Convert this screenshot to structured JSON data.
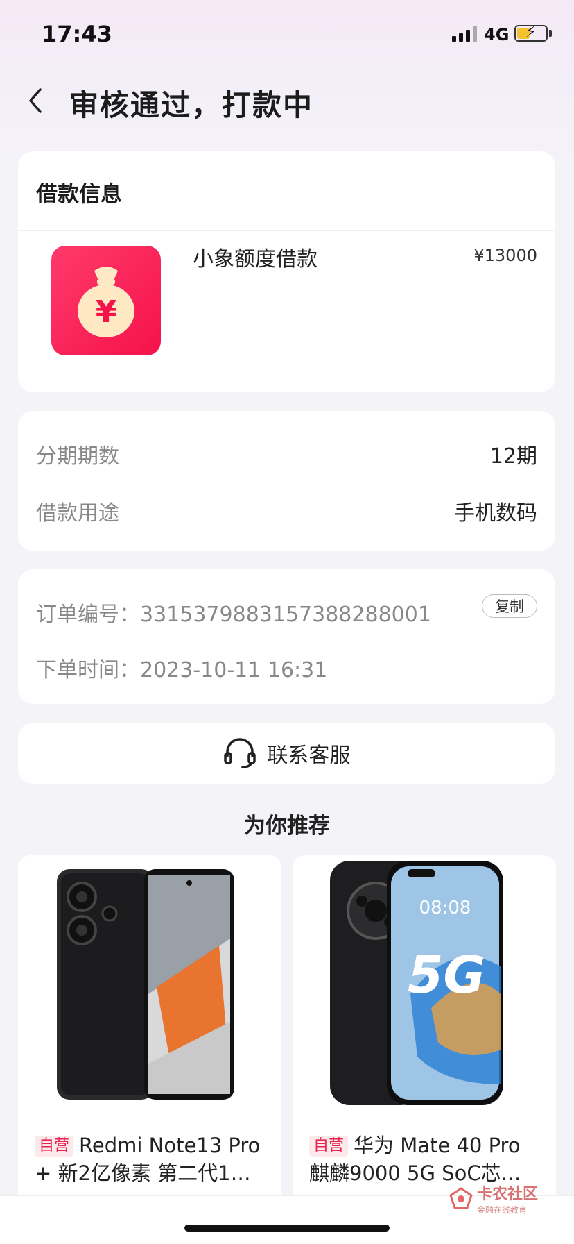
{
  "status": {
    "time": "17:43",
    "network": "4G"
  },
  "header": {
    "title": "审核通过，打款中"
  },
  "loan_info": {
    "section_title": "借款信息",
    "product_name": "小象额度借款",
    "amount": "¥13000",
    "icon": "money-bag-icon"
  },
  "details": {
    "rows": [
      {
        "label": "分期期数",
        "value": "12期"
      },
      {
        "label": "借款用途",
        "value": "手机数码"
      }
    ]
  },
  "order": {
    "number_label": "订单编号：",
    "number": "3315379883157388288001",
    "copy_label": "复制",
    "time_label": "下单时间：",
    "time": "2023-10-11 16:31"
  },
  "support": {
    "label": "联系客服",
    "icon": "headset-icon"
  },
  "recommend": {
    "title": "为你推荐",
    "products": [
      {
        "tag": "自营",
        "line1": "Redmi Note13 Pro",
        "line2": "+ 新2亿像素 第二代1…",
        "image": "redmi-phone-image"
      },
      {
        "tag": "自营",
        "line1": "华为 Mate 40 Pro",
        "line2": "麒麟9000 5G SoC芯…",
        "image": "huawei-phone-image",
        "screen_time": "08:08",
        "badge": "5G"
      }
    ]
  },
  "watermark": {
    "main": "卡农社区",
    "sub": "金融在线教育"
  },
  "colors": {
    "accent": "#f5124b",
    "tag_bg": "#fde8ec",
    "tag_text": "#e8234d",
    "background": "#f4f4f8"
  }
}
